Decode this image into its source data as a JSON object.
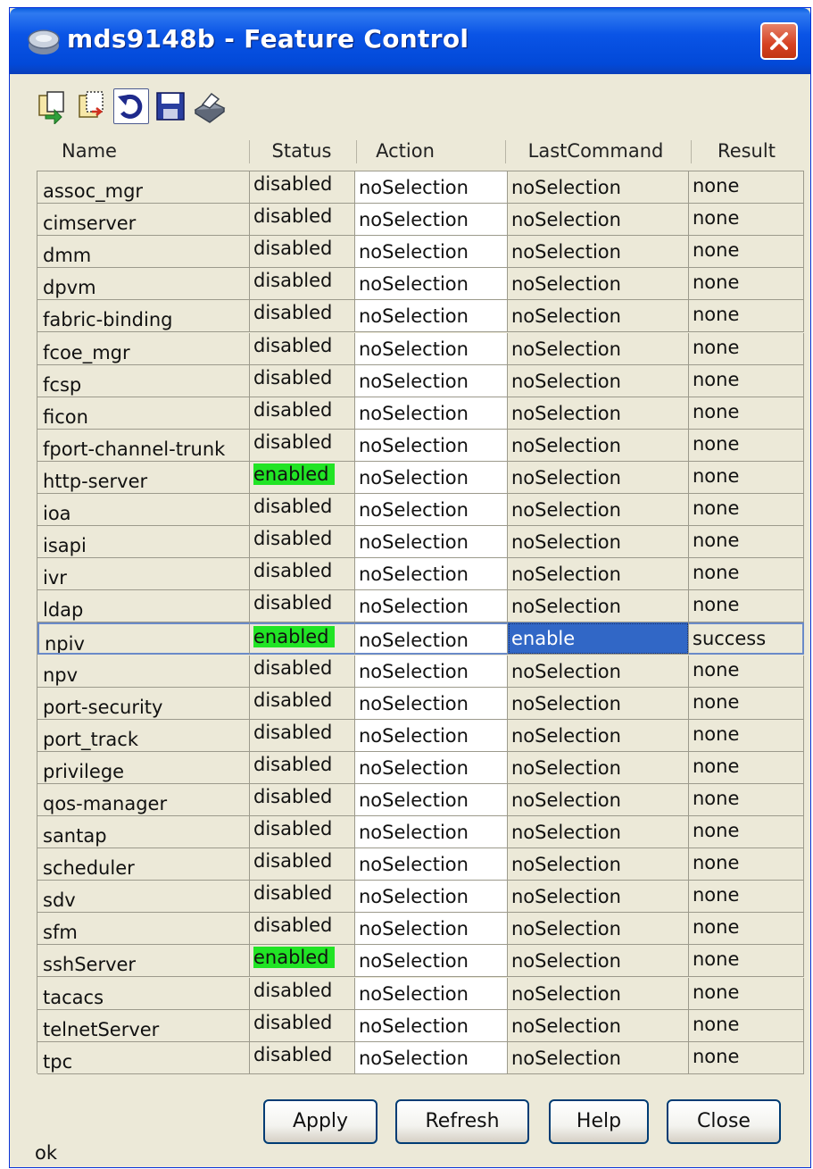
{
  "window": {
    "title": "mds9148b - Feature Control"
  },
  "toolbar": {
    "items": [
      {
        "name": "copy-icon"
      },
      {
        "name": "paste-icon"
      },
      {
        "name": "refresh-icon"
      },
      {
        "name": "save-icon"
      },
      {
        "name": "print-icon"
      }
    ]
  },
  "table": {
    "columns": [
      "Name",
      "Status",
      "Action",
      "LastCommand",
      "Result"
    ],
    "rows": [
      {
        "name": "assoc_mgr",
        "status": "disabled",
        "action": "noSelection",
        "last": "noSelection",
        "result": "none"
      },
      {
        "name": "cimserver",
        "status": "disabled",
        "action": "noSelection",
        "last": "noSelection",
        "result": "none"
      },
      {
        "name": "dmm",
        "status": "disabled",
        "action": "noSelection",
        "last": "noSelection",
        "result": "none"
      },
      {
        "name": "dpvm",
        "status": "disabled",
        "action": "noSelection",
        "last": "noSelection",
        "result": "none"
      },
      {
        "name": "fabric-binding",
        "status": "disabled",
        "action": "noSelection",
        "last": "noSelection",
        "result": "none"
      },
      {
        "name": "fcoe_mgr",
        "status": "disabled",
        "action": "noSelection",
        "last": "noSelection",
        "result": "none"
      },
      {
        "name": "fcsp",
        "status": "disabled",
        "action": "noSelection",
        "last": "noSelection",
        "result": "none"
      },
      {
        "name": "ficon",
        "status": "disabled",
        "action": "noSelection",
        "last": "noSelection",
        "result": "none"
      },
      {
        "name": "fport-channel-trunk",
        "status": "disabled",
        "action": "noSelection",
        "last": "noSelection",
        "result": "none"
      },
      {
        "name": "http-server",
        "status": "enabled",
        "action": "noSelection",
        "last": "noSelection",
        "result": "none"
      },
      {
        "name": "ioa",
        "status": "disabled",
        "action": "noSelection",
        "last": "noSelection",
        "result": "none"
      },
      {
        "name": "isapi",
        "status": "disabled",
        "action": "noSelection",
        "last": "noSelection",
        "result": "none"
      },
      {
        "name": "ivr",
        "status": "disabled",
        "action": "noSelection",
        "last": "noSelection",
        "result": "none"
      },
      {
        "name": "ldap",
        "status": "disabled",
        "action": "noSelection",
        "last": "noSelection",
        "result": "none"
      },
      {
        "name": "npiv",
        "status": "enabled",
        "action": "noSelection",
        "last": "enable",
        "result": "success",
        "selected": true
      },
      {
        "name": "npv",
        "status": "disabled",
        "action": "noSelection",
        "last": "noSelection",
        "result": "none"
      },
      {
        "name": "port-security",
        "status": "disabled",
        "action": "noSelection",
        "last": "noSelection",
        "result": "none"
      },
      {
        "name": "port_track",
        "status": "disabled",
        "action": "noSelection",
        "last": "noSelection",
        "result": "none"
      },
      {
        "name": "privilege",
        "status": "disabled",
        "action": "noSelection",
        "last": "noSelection",
        "result": "none"
      },
      {
        "name": "qos-manager",
        "status": "disabled",
        "action": "noSelection",
        "last": "noSelection",
        "result": "none"
      },
      {
        "name": "santap",
        "status": "disabled",
        "action": "noSelection",
        "last": "noSelection",
        "result": "none"
      },
      {
        "name": "scheduler",
        "status": "disabled",
        "action": "noSelection",
        "last": "noSelection",
        "result": "none"
      },
      {
        "name": "sdv",
        "status": "disabled",
        "action": "noSelection",
        "last": "noSelection",
        "result": "none"
      },
      {
        "name": "sfm",
        "status": "disabled",
        "action": "noSelection",
        "last": "noSelection",
        "result": "none"
      },
      {
        "name": "sshServer",
        "status": "enabled",
        "action": "noSelection",
        "last": "noSelection",
        "result": "none"
      },
      {
        "name": "tacacs",
        "status": "disabled",
        "action": "noSelection",
        "last": "noSelection",
        "result": "none"
      },
      {
        "name": "telnetServer",
        "status": "disabled",
        "action": "noSelection",
        "last": "noSelection",
        "result": "none"
      },
      {
        "name": "tpc",
        "status": "disabled",
        "action": "noSelection",
        "last": "noSelection",
        "result": "none"
      }
    ]
  },
  "buttons": {
    "apply": "Apply",
    "refresh": "Refresh",
    "help": "Help",
    "close": "Close"
  },
  "status_bar": {
    "text": "ok"
  },
  "colors": {
    "enabled": "#21E425",
    "selection": "#3167C6",
    "titlebar": "#0A54E6"
  }
}
